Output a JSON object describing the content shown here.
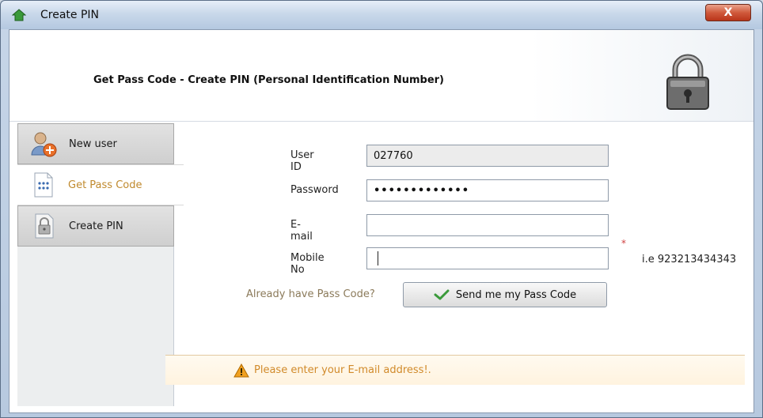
{
  "window": {
    "title": "Create PIN",
    "close_label": "X"
  },
  "header": {
    "title": "Get Pass Code - Create PIN (Personal Identification Number)"
  },
  "nav": {
    "items": [
      {
        "label": "New user",
        "icon": "new-user-icon"
      },
      {
        "label": "Get Pass Code",
        "icon": "pass-code-icon",
        "active": true
      },
      {
        "label": "Create PIN",
        "icon": "create-pin-icon"
      }
    ]
  },
  "form": {
    "user_id_label": "User ID",
    "user_id_value": "027760",
    "password_label": "Password",
    "password_value": "•••••••••••••",
    "email_label": "E-mail",
    "email_value": "",
    "email_required_marker": "*",
    "mobile_label": "Mobile No",
    "mobile_value": "",
    "mobile_hint": "i.e 923213434343"
  },
  "actions": {
    "already_text": "Already have Pass Code?",
    "send_label": "Send me my Pass Code"
  },
  "status": {
    "message": "Please enter your E-mail address!."
  },
  "colors": {
    "active_nav_text": "#c08a2e",
    "status_text": "#d18a2a",
    "warning_icon": "#f0a020"
  }
}
